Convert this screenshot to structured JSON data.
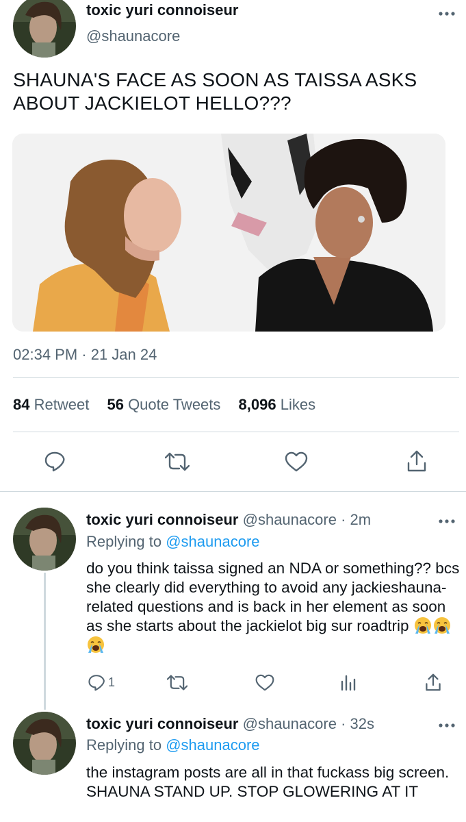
{
  "main_tweet": {
    "display_name": "toxic yuri connoiseur",
    "handle": "@shaunacore",
    "text": "SHAUNA'S FACE AS SOON AS TAISSA ASKS ABOUT JACKIELOT HELLO???",
    "timestamp": "02:34 PM · 21 Jan 24",
    "stats": {
      "retweets_count": "84",
      "retweets_label": "Retweet",
      "quotes_count": "56",
      "quotes_label": "Quote Tweets",
      "likes_count": "8,096",
      "likes_label": "Likes"
    },
    "actions": [
      "reply-icon",
      "retweet-icon",
      "like-icon",
      "share-icon"
    ]
  },
  "replies": [
    {
      "display_name": "toxic yuri connoiseur",
      "handle": "@shaunacore",
      "time": "· 2m",
      "replying_prefix": "Replying to",
      "replying_to": "@shaunacore",
      "text": "do you think taissa signed an NDA or something?? bcs she clearly did everything to avoid any jackieshauna-related questions and is back in her element as soon as she starts about the jackielot big sur roadtrip",
      "emoji": [
        "loudly-crying-face",
        "loudly-crying-face",
        "loudly-crying-face"
      ],
      "reply_count": "1",
      "actions": [
        "reply-icon",
        "retweet-icon",
        "like-icon",
        "analytics-icon",
        "share-icon"
      ]
    },
    {
      "display_name": "toxic yuri connoiseur",
      "handle": "@shaunacore",
      "time": "· 32s",
      "replying_prefix": "Replying to",
      "replying_to": "@shaunacore",
      "text": "the instagram posts are all in that fuckass big screen. SHAUNA STAND UP. STOP GLOWERING AT IT"
    }
  ],
  "colors": {
    "text": "#0f1419",
    "secondary": "#536471",
    "accent": "#1d9bf0",
    "divider": "#cfd9de"
  }
}
